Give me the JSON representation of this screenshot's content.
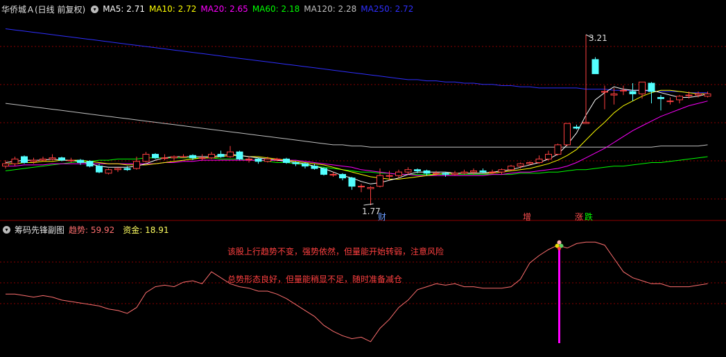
{
  "main_panel": {
    "title": "华侨城Ａ(日线 前复权)",
    "indicators": [
      {
        "label": "MA5: 2.71",
        "color": "#ffffff"
      },
      {
        "label": "MA10: 2.72",
        "color": "#ffff00"
      },
      {
        "label": "MA20: 2.65",
        "color": "#ff00ff"
      },
      {
        "label": "MA60: 2.18",
        "color": "#00ff00"
      },
      {
        "label": "MA120: 2.28",
        "color": "#c0c0c0"
      },
      {
        "label": "MA250: 2.72",
        "color": "#2f2fff"
      }
    ],
    "high_label": "3.21",
    "low_label": "1.77",
    "markers": [
      {
        "text": "财",
        "color": "#6a9cff"
      },
      {
        "text": "增",
        "color": "#ff5050"
      },
      {
        "text": "涨",
        "color": "#ff5050"
      },
      {
        "text": "跌",
        "color": "#00ff00"
      }
    ]
  },
  "sub_panel": {
    "title": "筹码先锋副图",
    "trend_label": "趋势",
    "trend_value": "59.92",
    "fund_label": "资金",
    "fund_value": "18.91",
    "message_top": "该股上行趋势不变，强势依然，但量能开始转弱，注意风险",
    "message_bottom": "总势形态良好，但量能稍显不足，随时准备减仓"
  },
  "colors": {
    "up": "#ff4040",
    "down": "#54ffff",
    "ma5": "#ffffff",
    "ma10": "#ffff00",
    "ma20": "#ff00ff",
    "ma60": "#00ff00",
    "ma120": "#c0c0c0",
    "ma250": "#2f2fff",
    "trend": "#ff6f6f",
    "signal": "#ff00ff"
  },
  "chart_data": {
    "type": "candlestick",
    "candles": [
      [
        2.1,
        2.12,
        2.15,
        2.08
      ],
      [
        2.12,
        2.16,
        2.18,
        2.1
      ],
      [
        2.18,
        2.13,
        2.19,
        2.12
      ],
      [
        2.14,
        2.15,
        2.17,
        2.12
      ],
      [
        2.15,
        2.16,
        2.18,
        2.14
      ],
      [
        2.16,
        2.17,
        2.2,
        2.15
      ],
      [
        2.17,
        2.15,
        2.18,
        2.14
      ],
      [
        2.15,
        2.15,
        2.17,
        2.13
      ],
      [
        2.15,
        2.13,
        2.16,
        2.11
      ],
      [
        2.14,
        2.1,
        2.15,
        2.09
      ],
      [
        2.1,
        2.05,
        2.12,
        2.04
      ],
      [
        2.04,
        2.07,
        2.08,
        2.03
      ],
      [
        2.07,
        2.08,
        2.09,
        2.05
      ],
      [
        2.08,
        2.07,
        2.1,
        2.06
      ],
      [
        2.08,
        2.14,
        2.18,
        2.07
      ],
      [
        2.14,
        2.2,
        2.22,
        2.13
      ],
      [
        2.2,
        2.17,
        2.21,
        2.16
      ],
      [
        2.17,
        2.17,
        2.2,
        2.15
      ],
      [
        2.17,
        2.18,
        2.19,
        2.15
      ],
      [
        2.18,
        2.18,
        2.2,
        2.17
      ],
      [
        2.19,
        2.17,
        2.2,
        2.15
      ],
      [
        2.17,
        2.17,
        2.2,
        2.15
      ],
      [
        2.17,
        2.2,
        2.22,
        2.16
      ],
      [
        2.2,
        2.18,
        2.23,
        2.17
      ],
      [
        2.18,
        2.22,
        2.27,
        2.17
      ],
      [
        2.22,
        2.16,
        2.23,
        2.15
      ],
      [
        2.16,
        2.16,
        2.18,
        2.13
      ],
      [
        2.16,
        2.14,
        2.17,
        2.12
      ],
      [
        2.14,
        2.16,
        2.18,
        2.13
      ],
      [
        2.16,
        2.16,
        2.17,
        2.14
      ],
      [
        2.16,
        2.13,
        2.17,
        2.12
      ],
      [
        2.13,
        2.12,
        2.14,
        2.1
      ],
      [
        2.12,
        2.1,
        2.13,
        2.08
      ],
      [
        2.1,
        2.08,
        2.12,
        2.07
      ],
      [
        2.08,
        2.03,
        2.09,
        2.02
      ],
      [
        2.03,
        2.03,
        2.05,
        2.01
      ],
      [
        2.03,
        2.0,
        2.04,
        1.98
      ],
      [
        2.0,
        1.93,
        2.01,
        1.9
      ],
      [
        1.93,
        1.93,
        1.95,
        1.88
      ],
      [
        1.91,
        1.92,
        1.93,
        1.77
      ],
      [
        1.93,
        2.02,
        2.08,
        1.92
      ],
      [
        2.02,
        2.02,
        2.06,
        1.98
      ],
      [
        2.02,
        2.05,
        2.07,
        2.0
      ],
      [
        2.05,
        2.07,
        2.09,
        2.03
      ],
      [
        2.07,
        2.06,
        2.08,
        2.04
      ],
      [
        2.06,
        2.04,
        2.07,
        2.02
      ],
      [
        2.04,
        2.04,
        2.06,
        2.02
      ],
      [
        2.04,
        2.03,
        2.05,
        2.01
      ],
      [
        2.03,
        2.04,
        2.06,
        2.02
      ],
      [
        2.04,
        2.05,
        2.07,
        2.03
      ],
      [
        2.05,
        2.06,
        2.08,
        2.03
      ],
      [
        2.06,
        2.05,
        2.08,
        2.04
      ],
      [
        2.05,
        2.05,
        2.07,
        2.04
      ],
      [
        2.05,
        2.07,
        2.08,
        2.03
      ],
      [
        2.07,
        2.1,
        2.11,
        2.06
      ],
      [
        2.1,
        2.12,
        2.13,
        2.08
      ],
      [
        2.12,
        2.13,
        2.14,
        2.11
      ],
      [
        2.13,
        2.16,
        2.19,
        2.12
      ],
      [
        2.16,
        2.2,
        2.23,
        2.15
      ],
      [
        2.2,
        2.28,
        2.29,
        2.19
      ],
      [
        2.28,
        2.46,
        2.46,
        2.27
      ],
      [
        2.43,
        2.42,
        2.45,
        2.41
      ],
      [
        2.46,
        2.47,
        3.21,
        2.46
      ],
      [
        3.0,
        2.88,
        3.02,
        2.88
      ],
      [
        2.73,
        2.73,
        2.78,
        2.58
      ],
      [
        2.7,
        2.71,
        2.76,
        2.62
      ],
      [
        2.74,
        2.74,
        2.78,
        2.7
      ],
      [
        2.73,
        2.71,
        2.8,
        2.65
      ],
      [
        2.71,
        2.81,
        2.81,
        2.67
      ],
      [
        2.8,
        2.73,
        2.81,
        2.63
      ],
      [
        2.68,
        2.67,
        2.7,
        2.57
      ],
      [
        2.65,
        2.65,
        2.68,
        2.62
      ],
      [
        2.66,
        2.69,
        2.7,
        2.63
      ],
      [
        2.7,
        2.7,
        2.73,
        2.67
      ],
      [
        2.7,
        2.71,
        2.73,
        2.68
      ],
      [
        2.69,
        2.71,
        2.73,
        2.68
      ]
    ],
    "ma": {
      "ma5": [
        2.13,
        2.14,
        2.15,
        2.15,
        2.15,
        2.16,
        2.15,
        2.15,
        2.14,
        2.12,
        2.1,
        2.09,
        2.09,
        2.09,
        2.1,
        2.12,
        2.15,
        2.17,
        2.18,
        2.18,
        2.18,
        2.18,
        2.18,
        2.19,
        2.2,
        2.19,
        2.18,
        2.17,
        2.16,
        2.15,
        2.14,
        2.13,
        2.12,
        2.1,
        2.08,
        2.05,
        2.02,
        2.0,
        1.97,
        1.95,
        1.96,
        1.98,
        2.0,
        2.03,
        2.05,
        2.05,
        2.05,
        2.05,
        2.04,
        2.04,
        2.04,
        2.04,
        2.05,
        2.06,
        2.07,
        2.09,
        2.11,
        2.13,
        2.16,
        2.2,
        2.28,
        2.38,
        2.53,
        2.66,
        2.72,
        2.77,
        2.75,
        2.74,
        2.74,
        2.74,
        2.72,
        2.7,
        2.68,
        2.68,
        2.69,
        2.71
      ],
      "ma10": [
        2.12,
        2.12,
        2.13,
        2.13,
        2.14,
        2.14,
        2.15,
        2.15,
        2.15,
        2.14,
        2.13,
        2.12,
        2.12,
        2.11,
        2.11,
        2.11,
        2.12,
        2.13,
        2.14,
        2.15,
        2.16,
        2.17,
        2.17,
        2.18,
        2.19,
        2.19,
        2.18,
        2.18,
        2.17,
        2.16,
        2.15,
        2.14,
        2.13,
        2.12,
        2.11,
        2.09,
        2.07,
        2.05,
        2.03,
        2.01,
        2.0,
        1.99,
        1.99,
        2.0,
        2.01,
        2.02,
        2.03,
        2.04,
        2.04,
        2.04,
        2.04,
        2.04,
        2.04,
        2.05,
        2.06,
        2.07,
        2.08,
        2.1,
        2.12,
        2.15,
        2.19,
        2.24,
        2.32,
        2.4,
        2.47,
        2.55,
        2.61,
        2.65,
        2.69,
        2.72,
        2.74,
        2.74,
        2.73,
        2.72,
        2.71,
        2.71
      ],
      "ma20": [
        2.1,
        2.1,
        2.11,
        2.11,
        2.11,
        2.12,
        2.12,
        2.12,
        2.12,
        2.12,
        2.12,
        2.12,
        2.12,
        2.12,
        2.12,
        2.12,
        2.12,
        2.13,
        2.13,
        2.14,
        2.14,
        2.15,
        2.15,
        2.15,
        2.15,
        2.15,
        2.15,
        2.15,
        2.15,
        2.15,
        2.15,
        2.15,
        2.14,
        2.13,
        2.12,
        2.11,
        2.1,
        2.09,
        2.07,
        2.06,
        2.05,
        2.04,
        2.03,
        2.03,
        2.02,
        2.02,
        2.02,
        2.02,
        2.02,
        2.02,
        2.02,
        2.02,
        2.03,
        2.03,
        2.04,
        2.05,
        2.05,
        2.06,
        2.07,
        2.08,
        2.1,
        2.13,
        2.17,
        2.21,
        2.25,
        2.3,
        2.35,
        2.4,
        2.44,
        2.48,
        2.52,
        2.55,
        2.58,
        2.61,
        2.63,
        2.65
      ],
      "ma60": [
        2.06,
        2.07,
        2.08,
        2.09,
        2.1,
        2.11,
        2.12,
        2.13,
        2.14,
        2.14,
        2.15,
        2.15,
        2.16,
        2.16,
        2.16,
        2.17,
        2.17,
        2.17,
        2.17,
        2.17,
        2.17,
        2.17,
        2.17,
        2.16,
        2.16,
        2.16,
        2.15,
        2.15,
        2.14,
        2.13,
        2.13,
        2.12,
        2.11,
        2.1,
        2.09,
        2.08,
        2.07,
        2.06,
        2.05,
        2.05,
        2.04,
        2.04,
        2.03,
        2.03,
        2.03,
        2.03,
        2.03,
        2.03,
        2.03,
        2.03,
        2.03,
        2.03,
        2.03,
        2.03,
        2.03,
        2.04,
        2.04,
        2.04,
        2.05,
        2.05,
        2.06,
        2.07,
        2.07,
        2.08,
        2.09,
        2.1,
        2.1,
        2.11,
        2.12,
        2.13,
        2.13,
        2.14,
        2.15,
        2.16,
        2.17,
        2.18
      ],
      "ma120": [
        2.63,
        2.62,
        2.61,
        2.6,
        2.59,
        2.58,
        2.57,
        2.56,
        2.55,
        2.54,
        2.53,
        2.52,
        2.51,
        2.5,
        2.49,
        2.48,
        2.47,
        2.46,
        2.45,
        2.44,
        2.43,
        2.42,
        2.41,
        2.4,
        2.39,
        2.38,
        2.37,
        2.36,
        2.35,
        2.34,
        2.33,
        2.32,
        2.31,
        2.3,
        2.29,
        2.28,
        2.28,
        2.27,
        2.27,
        2.26,
        2.26,
        2.26,
        2.26,
        2.26,
        2.26,
        2.26,
        2.26,
        2.26,
        2.26,
        2.26,
        2.26,
        2.26,
        2.26,
        2.26,
        2.26,
        2.26,
        2.26,
        2.26,
        2.26,
        2.26,
        2.26,
        2.26,
        2.26,
        2.26,
        2.26,
        2.26,
        2.26,
        2.26,
        2.26,
        2.26,
        2.27,
        2.27,
        2.27,
        2.27,
        2.27,
        2.28
      ],
      "ma250": [
        3.26,
        3.25,
        3.24,
        3.23,
        3.22,
        3.21,
        3.2,
        3.19,
        3.18,
        3.17,
        3.16,
        3.15,
        3.14,
        3.13,
        3.12,
        3.11,
        3.1,
        3.09,
        3.08,
        3.07,
        3.06,
        3.05,
        3.04,
        3.03,
        3.02,
        3.01,
        3.0,
        2.99,
        2.98,
        2.97,
        2.96,
        2.95,
        2.94,
        2.93,
        2.92,
        2.91,
        2.9,
        2.89,
        2.88,
        2.87,
        2.86,
        2.85,
        2.84,
        2.83,
        2.83,
        2.82,
        2.82,
        2.81,
        2.81,
        2.8,
        2.8,
        2.79,
        2.79,
        2.78,
        2.78,
        2.77,
        2.77,
        2.76,
        2.76,
        2.76,
        2.76,
        2.76,
        2.75,
        2.75,
        2.75,
        2.74,
        2.74,
        2.74,
        2.74,
        2.73,
        2.73,
        2.73,
        2.73,
        2.72,
        2.72,
        2.72
      ]
    },
    "trend": [
      [
        0,
        66
      ],
      [
        1,
        66
      ],
      [
        2,
        64
      ],
      [
        3,
        62
      ],
      [
        4,
        64
      ],
      [
        5,
        62
      ],
      [
        6,
        58
      ],
      [
        7,
        56
      ],
      [
        8,
        54
      ],
      [
        9,
        52
      ],
      [
        10,
        50
      ],
      [
        11,
        46
      ],
      [
        12,
        44
      ],
      [
        13,
        40
      ],
      [
        14,
        48
      ],
      [
        15,
        68
      ],
      [
        16,
        76
      ],
      [
        17,
        78
      ],
      [
        18,
        76
      ],
      [
        19,
        82
      ],
      [
        20,
        84
      ],
      [
        21,
        80
      ],
      [
        22,
        96
      ],
      [
        23,
        88
      ],
      [
        24,
        80
      ],
      [
        25,
        76
      ],
      [
        26,
        74
      ],
      [
        27,
        70
      ],
      [
        28,
        70
      ],
      [
        29,
        66
      ],
      [
        30,
        60
      ],
      [
        31,
        52
      ],
      [
        32,
        44
      ],
      [
        33,
        36
      ],
      [
        34,
        24
      ],
      [
        35,
        16
      ],
      [
        36,
        10
      ],
      [
        37,
        6
      ],
      [
        38,
        8
      ],
      [
        39,
        2
      ],
      [
        40,
        20
      ],
      [
        41,
        32
      ],
      [
        42,
        48
      ],
      [
        43,
        58
      ],
      [
        44,
        72
      ],
      [
        45,
        76
      ],
      [
        46,
        80
      ],
      [
        47,
        78
      ],
      [
        48,
        80
      ],
      [
        49,
        76
      ],
      [
        50,
        76
      ],
      [
        51,
        74
      ],
      [
        52,
        74
      ],
      [
        53,
        74
      ],
      [
        54,
        76
      ],
      [
        55,
        86
      ],
      [
        56,
        108
      ],
      [
        57,
        118
      ],
      [
        58,
        126
      ],
      [
        59,
        132
      ],
      [
        60,
        128
      ],
      [
        61,
        134
      ],
      [
        62,
        136
      ],
      [
        63,
        136
      ],
      [
        64,
        132
      ],
      [
        65,
        114
      ],
      [
        66,
        96
      ],
      [
        67,
        88
      ],
      [
        68,
        84
      ],
      [
        69,
        80
      ],
      [
        70,
        80
      ],
      [
        71,
        76
      ],
      [
        72,
        76
      ],
      [
        73,
        76
      ],
      [
        74,
        78
      ],
      [
        75,
        80
      ]
    ],
    "trend_range": [
      0,
      140
    ],
    "signal_index": 59
  }
}
